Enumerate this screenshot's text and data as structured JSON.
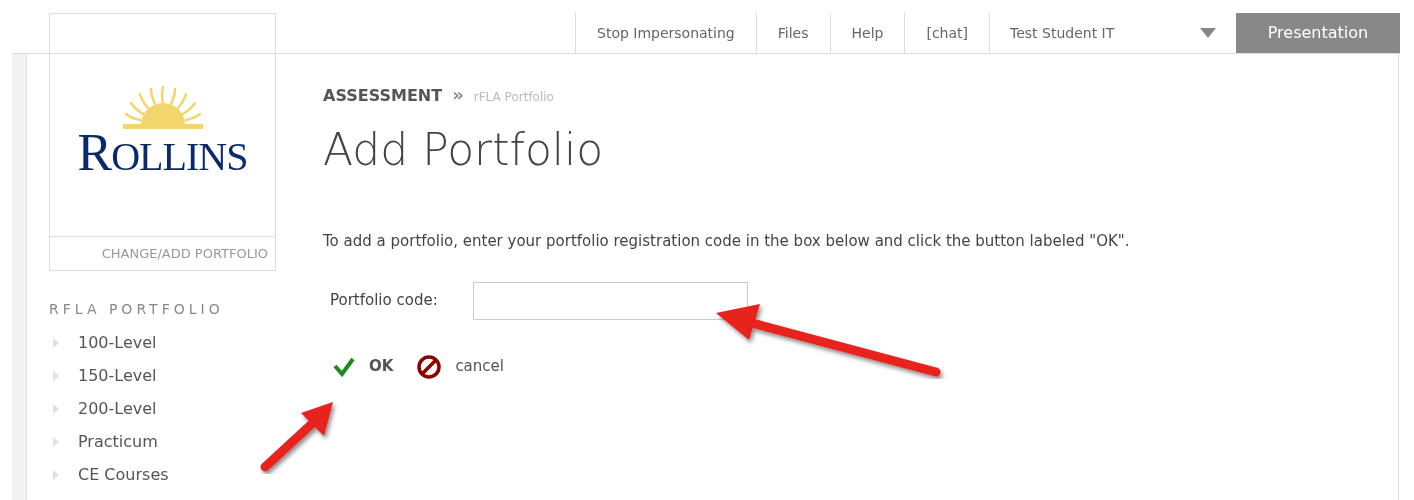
{
  "top_nav": {
    "items": [
      {
        "label": "Stop Impersonating"
      },
      {
        "label": "Files"
      },
      {
        "label": "Help"
      },
      {
        "label": "[chat]"
      },
      {
        "label": "Test Student IT"
      }
    ],
    "presentation_button": "Presentation"
  },
  "logo": {
    "text": "ROLLINS"
  },
  "change_portfolio_link": "CHANGE/ADD PORTFOLIO",
  "sidebar": {
    "heading": "RFLA PORTFOLIO",
    "items": [
      {
        "label": "100-Level"
      },
      {
        "label": "150-Level"
      },
      {
        "label": "200-Level"
      },
      {
        "label": "Practicum"
      },
      {
        "label": "CE Courses"
      }
    ]
  },
  "breadcrumb": {
    "section": "ASSESSMENT",
    "separator": "»",
    "current": "rFLA Portfolio"
  },
  "title": "Add Portfolio",
  "instructions": "To add a portfolio, enter your portfolio registration code in the box below and click the button labeled \"OK\".",
  "form": {
    "label": "Portfolio code:"
  },
  "actions": [
    {
      "kind": "ok",
      "label": "OK"
    },
    {
      "kind": "cancel",
      "label": "cancel"
    }
  ]
}
